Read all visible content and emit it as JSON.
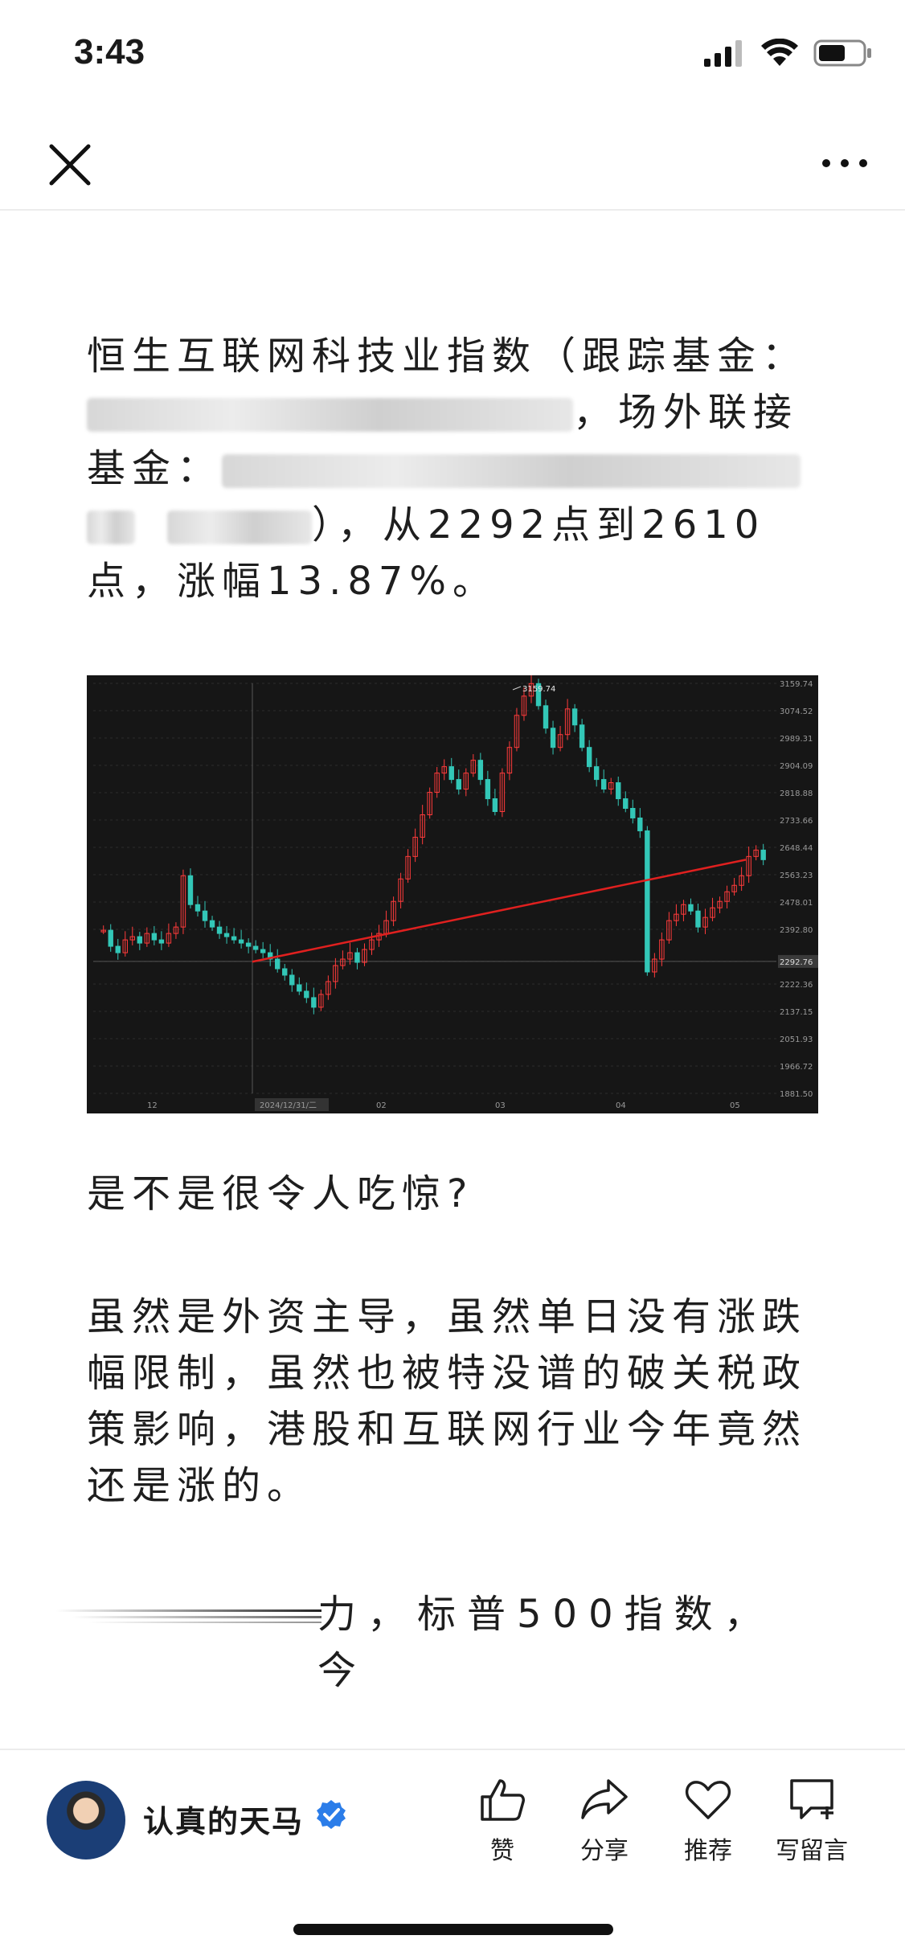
{
  "status_bar": {
    "time": "3:43"
  },
  "article": {
    "para1": {
      "line1": "恒生互联网科技业指数（跟踪基金：",
      "line2_visible": "，场外联接",
      "line3": "基金：",
      "line4_visible": "），从2292点到2610",
      "line5": "点，涨幅13.87%。"
    },
    "para2": "是不是很令人吃惊?",
    "para3": {
      "line1": "虽然是外资主导，虽然单日没有涨跌",
      "line2": "幅限制，虽然也被特没谱的破关税政",
      "line3": "策影响，港股和互联网行业今年竟然",
      "line4": "还是涨的。"
    },
    "para4_visible": "力，标普500指数，今"
  },
  "chart_data": {
    "type": "candlestick",
    "y_ticks": [
      "3159.74",
      "3074.52",
      "2989.31",
      "2904.09",
      "2818.88",
      "2733.66",
      "2648.44",
      "2563.23",
      "2478.01",
      "2392.80",
      "2292.76",
      "2222.36",
      "2137.15",
      "2051.93",
      "1966.72",
      "1881.50"
    ],
    "y_range": [
      1881.5,
      3159.74
    ],
    "x_ticks": [
      "12",
      "2024/12/31/二",
      "02",
      "03",
      "04",
      "05"
    ],
    "peak_label": "3159.74",
    "current_price_label": "2292.76",
    "trend_line": {
      "from": 2292,
      "to": 2610
    },
    "colors": {
      "up": "#ff3b3b",
      "down": "#33c7b7",
      "trend": "#e0201f",
      "background": "#161616"
    }
  },
  "bottom_bar": {
    "author": "认真的天马",
    "actions": [
      {
        "label": "赞",
        "icon": "thumbs-up-icon"
      },
      {
        "label": "分享",
        "icon": "share-icon"
      },
      {
        "label": "推荐",
        "icon": "heart-icon"
      },
      {
        "label": "写留言",
        "icon": "comment-icon"
      }
    ]
  }
}
